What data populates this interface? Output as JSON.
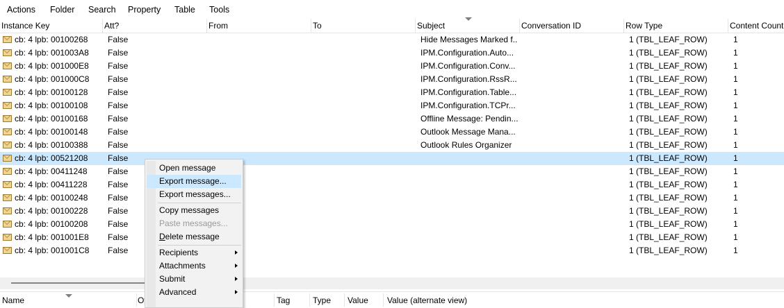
{
  "menu": [
    "Actions",
    "Folder",
    "Search",
    "Property",
    "Table",
    "Tools"
  ],
  "columns": [
    "Instance Key",
    "Att?",
    "From",
    "To",
    "Subject",
    "Conversation ID",
    "Row Type",
    "Content Count"
  ],
  "rows": [
    {
      "key": "cb: 4 lpb: 00100268",
      "att": "False",
      "from": "",
      "to": "",
      "subject": "Hide Messages Marked f...",
      "conv": "",
      "rowtype": "1 (TBL_LEAF_ROW)",
      "count": "1"
    },
    {
      "key": "cb: 4 lpb: 001003A8",
      "att": "False",
      "from": "",
      "to": "",
      "subject": "IPM.Configuration.Auto...",
      "conv": "",
      "rowtype": "1 (TBL_LEAF_ROW)",
      "count": "1"
    },
    {
      "key": "cb: 4 lpb: 001000E8",
      "att": "False",
      "from": "",
      "to": "",
      "subject": "IPM.Configuration.Conv...",
      "conv": "",
      "rowtype": "1 (TBL_LEAF_ROW)",
      "count": "1"
    },
    {
      "key": "cb: 4 lpb: 001000C8",
      "att": "False",
      "from": "",
      "to": "",
      "subject": "IPM.Configuration.RssR...",
      "conv": "",
      "rowtype": "1 (TBL_LEAF_ROW)",
      "count": "1"
    },
    {
      "key": "cb: 4 lpb: 00100128",
      "att": "False",
      "from": "",
      "to": "",
      "subject": "IPM.Configuration.Table...",
      "conv": "",
      "rowtype": "1 (TBL_LEAF_ROW)",
      "count": "1"
    },
    {
      "key": "cb: 4 lpb: 00100108",
      "att": "False",
      "from": "",
      "to": "",
      "subject": "IPM.Configuration.TCPr...",
      "conv": "",
      "rowtype": "1 (TBL_LEAF_ROW)",
      "count": "1"
    },
    {
      "key": "cb: 4 lpb: 00100168",
      "att": "False",
      "from": "",
      "to": "",
      "subject": "Offline Message: Pendin...",
      "conv": "",
      "rowtype": "1 (TBL_LEAF_ROW)",
      "count": "1"
    },
    {
      "key": "cb: 4 lpb: 00100148",
      "att": "False",
      "from": "",
      "to": "",
      "subject": "Outlook Message Mana...",
      "conv": "",
      "rowtype": "1 (TBL_LEAF_ROW)",
      "count": "1"
    },
    {
      "key": "cb: 4 lpb: 00100388",
      "att": "False",
      "from": "",
      "to": "",
      "subject": "Outlook Rules Organizer",
      "conv": "",
      "rowtype": "1 (TBL_LEAF_ROW)",
      "count": "1"
    },
    {
      "key": "cb: 4 lpb: 00521208",
      "att": "False",
      "from": "",
      "to": "",
      "subject": "",
      "conv": "",
      "rowtype": "1 (TBL_LEAF_ROW)",
      "count": "1",
      "selected": true
    },
    {
      "key": "cb: 4 lpb: 00411248",
      "att": "False",
      "from": "",
      "to": "",
      "subject": "",
      "conv": "",
      "rowtype": "1 (TBL_LEAF_ROW)",
      "count": "1"
    },
    {
      "key": "cb: 4 lpb: 00411228",
      "att": "False",
      "from": "",
      "to": "",
      "subject": "",
      "conv": "",
      "rowtype": "1 (TBL_LEAF_ROW)",
      "count": "1"
    },
    {
      "key": "cb: 4 lpb: 00100248",
      "att": "False",
      "from": "",
      "to": "",
      "subject": "",
      "conv": "",
      "rowtype": "1 (TBL_LEAF_ROW)",
      "count": "1"
    },
    {
      "key": "cb: 4 lpb: 00100228",
      "att": "False",
      "from": "",
      "to": "",
      "subject": "",
      "conv": "",
      "rowtype": "1 (TBL_LEAF_ROW)",
      "count": "1"
    },
    {
      "key": "cb: 4 lpb: 00100208",
      "att": "False",
      "from": "",
      "to": "",
      "subject": "",
      "conv": "",
      "rowtype": "1 (TBL_LEAF_ROW)",
      "count": "1"
    },
    {
      "key": "cb: 4 lpb: 001001E8",
      "att": "False",
      "from": "",
      "to": "",
      "subject": "",
      "conv": "",
      "rowtype": "1 (TBL_LEAF_ROW)",
      "count": "1"
    },
    {
      "key": "cb: 4 lpb: 001001C8",
      "att": "False",
      "from": "",
      "to": "",
      "subject": "",
      "conv": "",
      "rowtype": "1 (TBL_LEAF_ROW)",
      "count": "1"
    }
  ],
  "context_menu": [
    {
      "label": "Open message",
      "type": "item"
    },
    {
      "label": "Export message...",
      "type": "item",
      "highlighted": true
    },
    {
      "label": "Export messages...",
      "type": "item"
    },
    {
      "type": "separator"
    },
    {
      "label": "Copy messages",
      "type": "item"
    },
    {
      "label": "Paste messages...",
      "type": "item",
      "disabled": true
    },
    {
      "label": "Delete message",
      "type": "item"
    },
    {
      "type": "separator"
    },
    {
      "label": "Recipients",
      "type": "submenu"
    },
    {
      "label": "Attachments",
      "type": "submenu"
    },
    {
      "label": "Submit",
      "type": "submenu"
    },
    {
      "label": "Advanced",
      "type": "submenu"
    }
  ],
  "bottom_columns": [
    "Name",
    "Ot",
    "Tag",
    "Type",
    "Value",
    "Value (alternate view)"
  ],
  "colors": {
    "selection": "#cce8ff",
    "disabled_text": "#9a9a9a",
    "menu_bg": "#f2f2f2"
  },
  "icons": {
    "row": "envelope-icon",
    "sort": "sort-descending-icon",
    "submenu": "submenu-arrow-icon"
  }
}
